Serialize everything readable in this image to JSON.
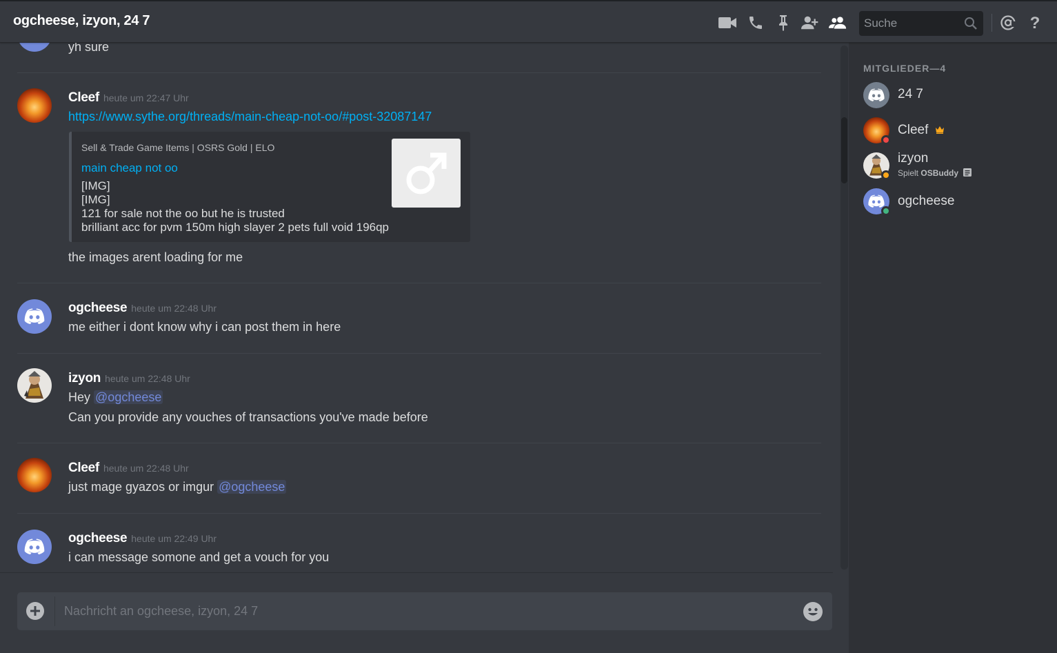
{
  "header": {
    "title": "ogcheese, izyon, 24 7",
    "search_placeholder": "Suche",
    "icons": [
      "video-icon",
      "phone-icon",
      "pin-icon",
      "add-member-icon",
      "members-icon",
      "search-icon",
      "mention-icon",
      "help-icon"
    ]
  },
  "messages": [
    {
      "id": "m0",
      "text": "yh sure"
    },
    {
      "id": "m1",
      "username": "Cleef",
      "timestamp": "heute um 22:47 Uhr",
      "link": "https://www.sythe.org/threads/main-cheap-not-oo/#post-32087147",
      "embed": {
        "provider": "Sell & Trade Game Items | OSRS Gold | ELO",
        "title": "main cheap not oo",
        "lines": [
          "[IMG]",
          "[IMG]",
          "121 for sale not the oo but he is trusted",
          "brilliant acc for pvm 150m high slayer 2 pets full void 196qp"
        ]
      },
      "text": "the images arent loading for me"
    },
    {
      "id": "m2",
      "username": "ogcheese",
      "timestamp": "heute um 22:48 Uhr",
      "text": "me either i dont know why i can post them in here"
    },
    {
      "id": "m3",
      "username": "izyon",
      "timestamp": "heute um 22:48 Uhr",
      "line1_prefix": "Hey",
      "line1_mention": "@ogcheese",
      "line2": "Can you provide any vouches of transactions you've made before"
    },
    {
      "id": "m4",
      "username": "Cleef",
      "timestamp": "heute um 22:48 Uhr",
      "text_prefix": "just mage gyazos or imgur",
      "mention": "@ogcheese"
    },
    {
      "id": "m5",
      "username": "ogcheese",
      "timestamp": "heute um 22:49 Uhr",
      "text": "i can message somone and get a vouch for you"
    }
  ],
  "composer": {
    "placeholder": "Nachricht an ogcheese, izyon, 24 7"
  },
  "members": {
    "header": "MITGLIEDER—4",
    "list": [
      {
        "name": "24 7",
        "avatar": "discord",
        "status": null
      },
      {
        "name": "Cleef",
        "avatar": "fire",
        "status": "dnd",
        "owner": true
      },
      {
        "name": "izyon",
        "avatar": "izyon",
        "status": "idle",
        "activity_prefix": "Spielt",
        "activity_game": "OSBuddy"
      },
      {
        "name": "ogcheese",
        "avatar": "discord",
        "status": "online"
      }
    ]
  },
  "colors": {
    "background": "#36393f",
    "sidebar": "#2f3136",
    "blurple": "#7289da",
    "link": "#00b0f4",
    "online": "#43b581",
    "idle": "#faa61a",
    "dnd": "#f04747",
    "crown": "#faa61a"
  }
}
